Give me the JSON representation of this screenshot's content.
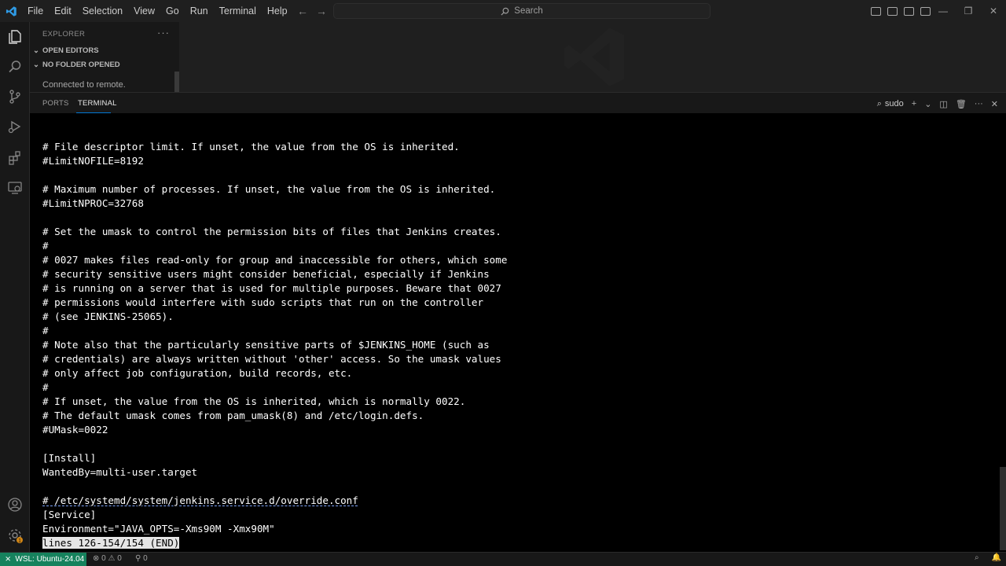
{
  "titlebar": {
    "menu": [
      "File",
      "Edit",
      "Selection",
      "View",
      "Go",
      "Run",
      "Terminal",
      "Help"
    ],
    "search_placeholder": "Search"
  },
  "sidebar": {
    "title": "EXPLORER",
    "sections": [
      "OPEN EDITORS",
      "NO FOLDER OPENED"
    ],
    "remote_status": "Connected to remote."
  },
  "panel": {
    "tabs": [
      "PORTS",
      "TERMINAL"
    ],
    "active_tab": "TERMINAL",
    "terminal_name": "sudo"
  },
  "terminal": {
    "lines": [
      "# File descriptor limit. If unset, the value from the OS is inherited.",
      "#LimitNOFILE=8192",
      "",
      "# Maximum number of processes. If unset, the value from the OS is inherited.",
      "#LimitNPROC=32768",
      "",
      "# Set the umask to control the permission bits of files that Jenkins creates.",
      "#",
      "# 0027 makes files read-only for group and inaccessible for others, which some",
      "# security sensitive users might consider beneficial, especially if Jenkins",
      "# is running on a server that is used for multiple purposes. Beware that 0027",
      "# permissions would interfere with sudo scripts that run on the controller",
      "# (see JENKINS-25065).",
      "#",
      "# Note also that the particularly sensitive parts of $JENKINS_HOME (such as",
      "# credentials) are always written without 'other' access. So the umask values",
      "# only affect job configuration, build records, etc.",
      "#",
      "# If unset, the value from the OS is inherited, which is normally 0022.",
      "# The default umask comes from pam_umask(8) and /etc/login.defs.",
      "#UMask=0022",
      "",
      "[Install]",
      "WantedBy=multi-user.target",
      "",
      "# /etc/systemd/system/jenkins.service.d/override.conf",
      "[Service]",
      "Environment=\"JAVA_OPTS=-Xms90M -Xmx90M\""
    ],
    "pager_status": "lines 126-154/154 (END)"
  },
  "statusbar": {
    "remote": "WSL: Ubuntu-24.04",
    "errors": "0",
    "warnings": "0",
    "ports": "0"
  },
  "colors": {
    "accent": "#0078d4",
    "remote_bg": "#16825d",
    "terminal_bg": "#000000"
  }
}
